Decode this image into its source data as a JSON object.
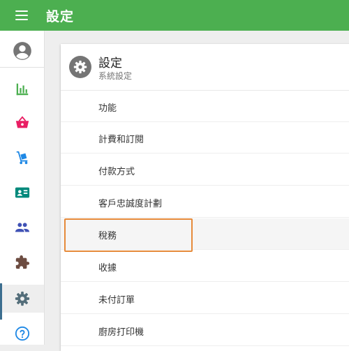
{
  "app": {
    "title": "設定"
  },
  "sidebar": {
    "items": [
      {
        "icon": "account-circle-icon",
        "color": "#757575",
        "active": false
      },
      {
        "icon": "bar-chart-icon",
        "color": "#4caf50",
        "active": false
      },
      {
        "icon": "shopping-basket-icon",
        "color": "#e91e63",
        "active": false
      },
      {
        "icon": "hand-truck-icon",
        "color": "#1e88e5",
        "active": false
      },
      {
        "icon": "contact-card-icon",
        "color": "#00897b",
        "active": false
      },
      {
        "icon": "people-icon",
        "color": "#3f51b5",
        "active": false
      },
      {
        "icon": "puzzle-icon",
        "color": "#6d4c41",
        "active": false
      },
      {
        "icon": "gear-icon",
        "color": "#546e7a",
        "active": true
      },
      {
        "icon": "help-circle-icon",
        "color": "#1e88e5",
        "active": false
      }
    ]
  },
  "settings": {
    "header": {
      "title": "設定",
      "subtitle": "系統設定",
      "icon": "gear-icon"
    },
    "items": [
      {
        "label": "功能"
      },
      {
        "label": "計費和訂閱"
      },
      {
        "label": "付款方式"
      },
      {
        "label": "客戶忠誠度計劃"
      },
      {
        "label": "稅務"
      },
      {
        "label": "收據"
      },
      {
        "label": "未付訂單"
      },
      {
        "label": "廚房打印機"
      }
    ],
    "highlighted_item": "稅務"
  },
  "colors": {
    "topbar": "#4caf50",
    "focus_outline": "#e68a3a",
    "active_indicator": "#3c6e8f"
  }
}
